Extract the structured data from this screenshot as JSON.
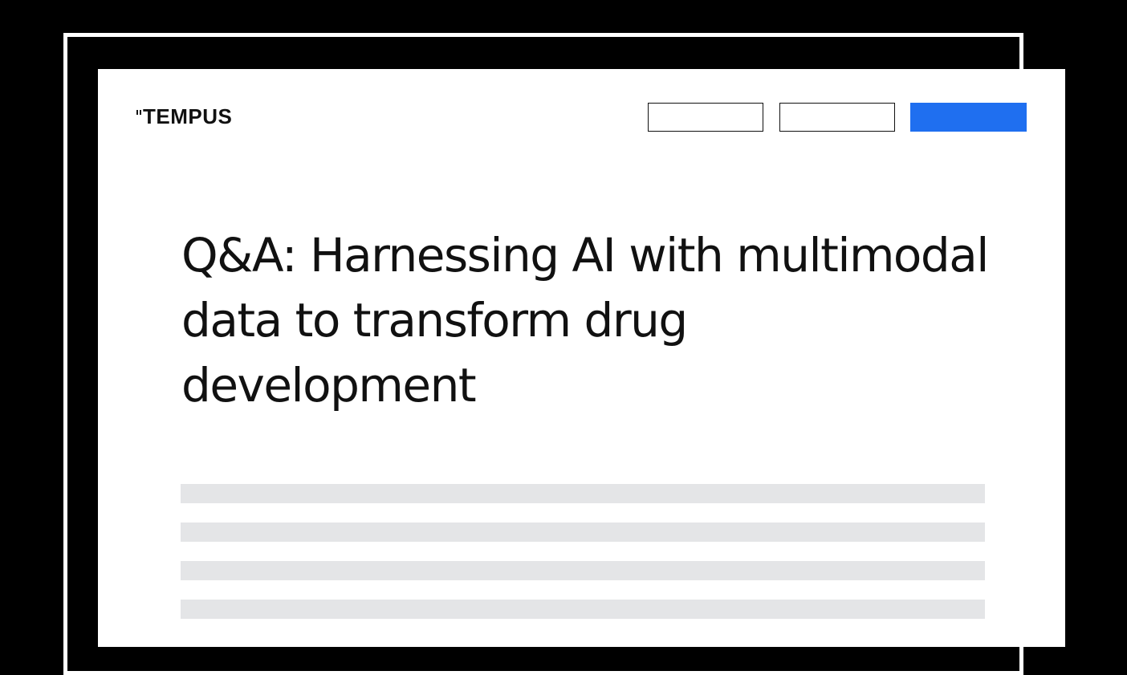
{
  "brand": {
    "logo_text": "TEMPUS",
    "logo_icon": "tempus-tick-marks-icon"
  },
  "header": {
    "nav_buttons": [
      {
        "label": "",
        "style": "outline"
      },
      {
        "label": "",
        "style": "outline"
      },
      {
        "label": "",
        "style": "filled",
        "color": "#1f6ff0"
      }
    ]
  },
  "article": {
    "title": "Q&A: Harnessing AI with multimodal data to transform drug development"
  },
  "colors": {
    "background": "#000000",
    "card": "#ffffff",
    "accent": "#1f6ff0",
    "text": "#111111",
    "placeholder": "#e4e5e7"
  }
}
